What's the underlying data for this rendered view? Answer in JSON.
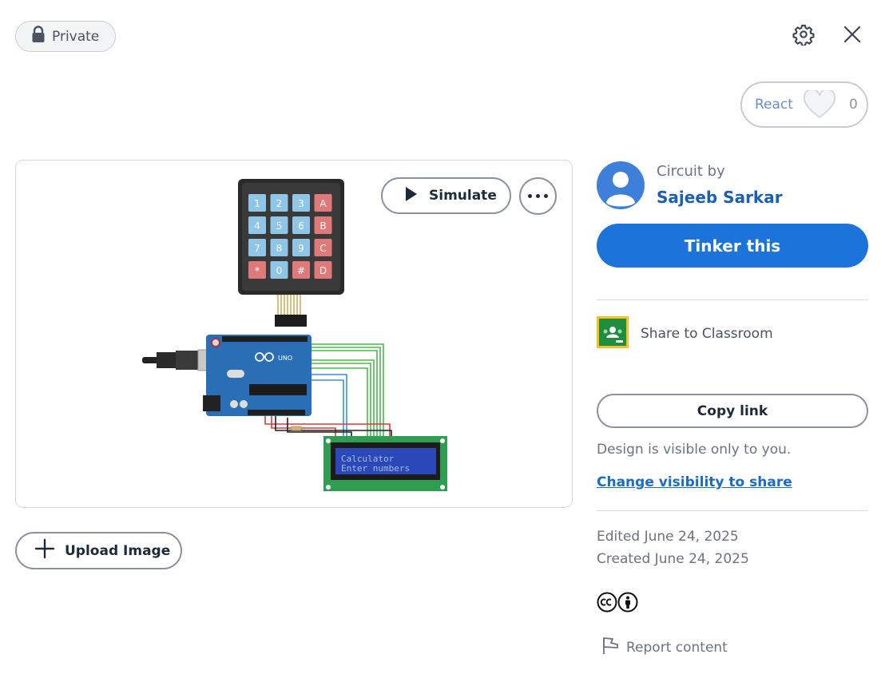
{
  "header": {
    "privacy_label": "Private",
    "settings_icon": "gear-icon",
    "close_icon": "close-icon"
  },
  "react": {
    "label": "React",
    "count": "0"
  },
  "preview": {
    "simulate_label": "Simulate",
    "keypad_keys": [
      "1",
      "2",
      "3",
      "A",
      "4",
      "5",
      "6",
      "B",
      "7",
      "8",
      "9",
      "C",
      "*",
      "0",
      "#",
      "D"
    ],
    "board_label": "UNO",
    "lcd_line1": "Calculator",
    "lcd_line2": "Enter numbers"
  },
  "upload": {
    "label": "Upload Image"
  },
  "author": {
    "prefix": "Circuit by",
    "name": "Sajeeb Sarkar"
  },
  "actions": {
    "tinker_label": "Tinker this",
    "classroom_label": "Share to Classroom",
    "copy_link_label": "Copy link",
    "visibility_note": "Design is visible only to you.",
    "visibility_link": "Change visibility to share"
  },
  "meta": {
    "edited": "Edited June 24, 2025",
    "created": "Created June 24, 2025",
    "report_label": "Report content"
  },
  "colors": {
    "primary": "#1c73d9",
    "link": "#1a6cc9",
    "board": "#2a6fb5",
    "lcd_screen": "#1f3fa8",
    "classroom": "#1e8e3e"
  }
}
